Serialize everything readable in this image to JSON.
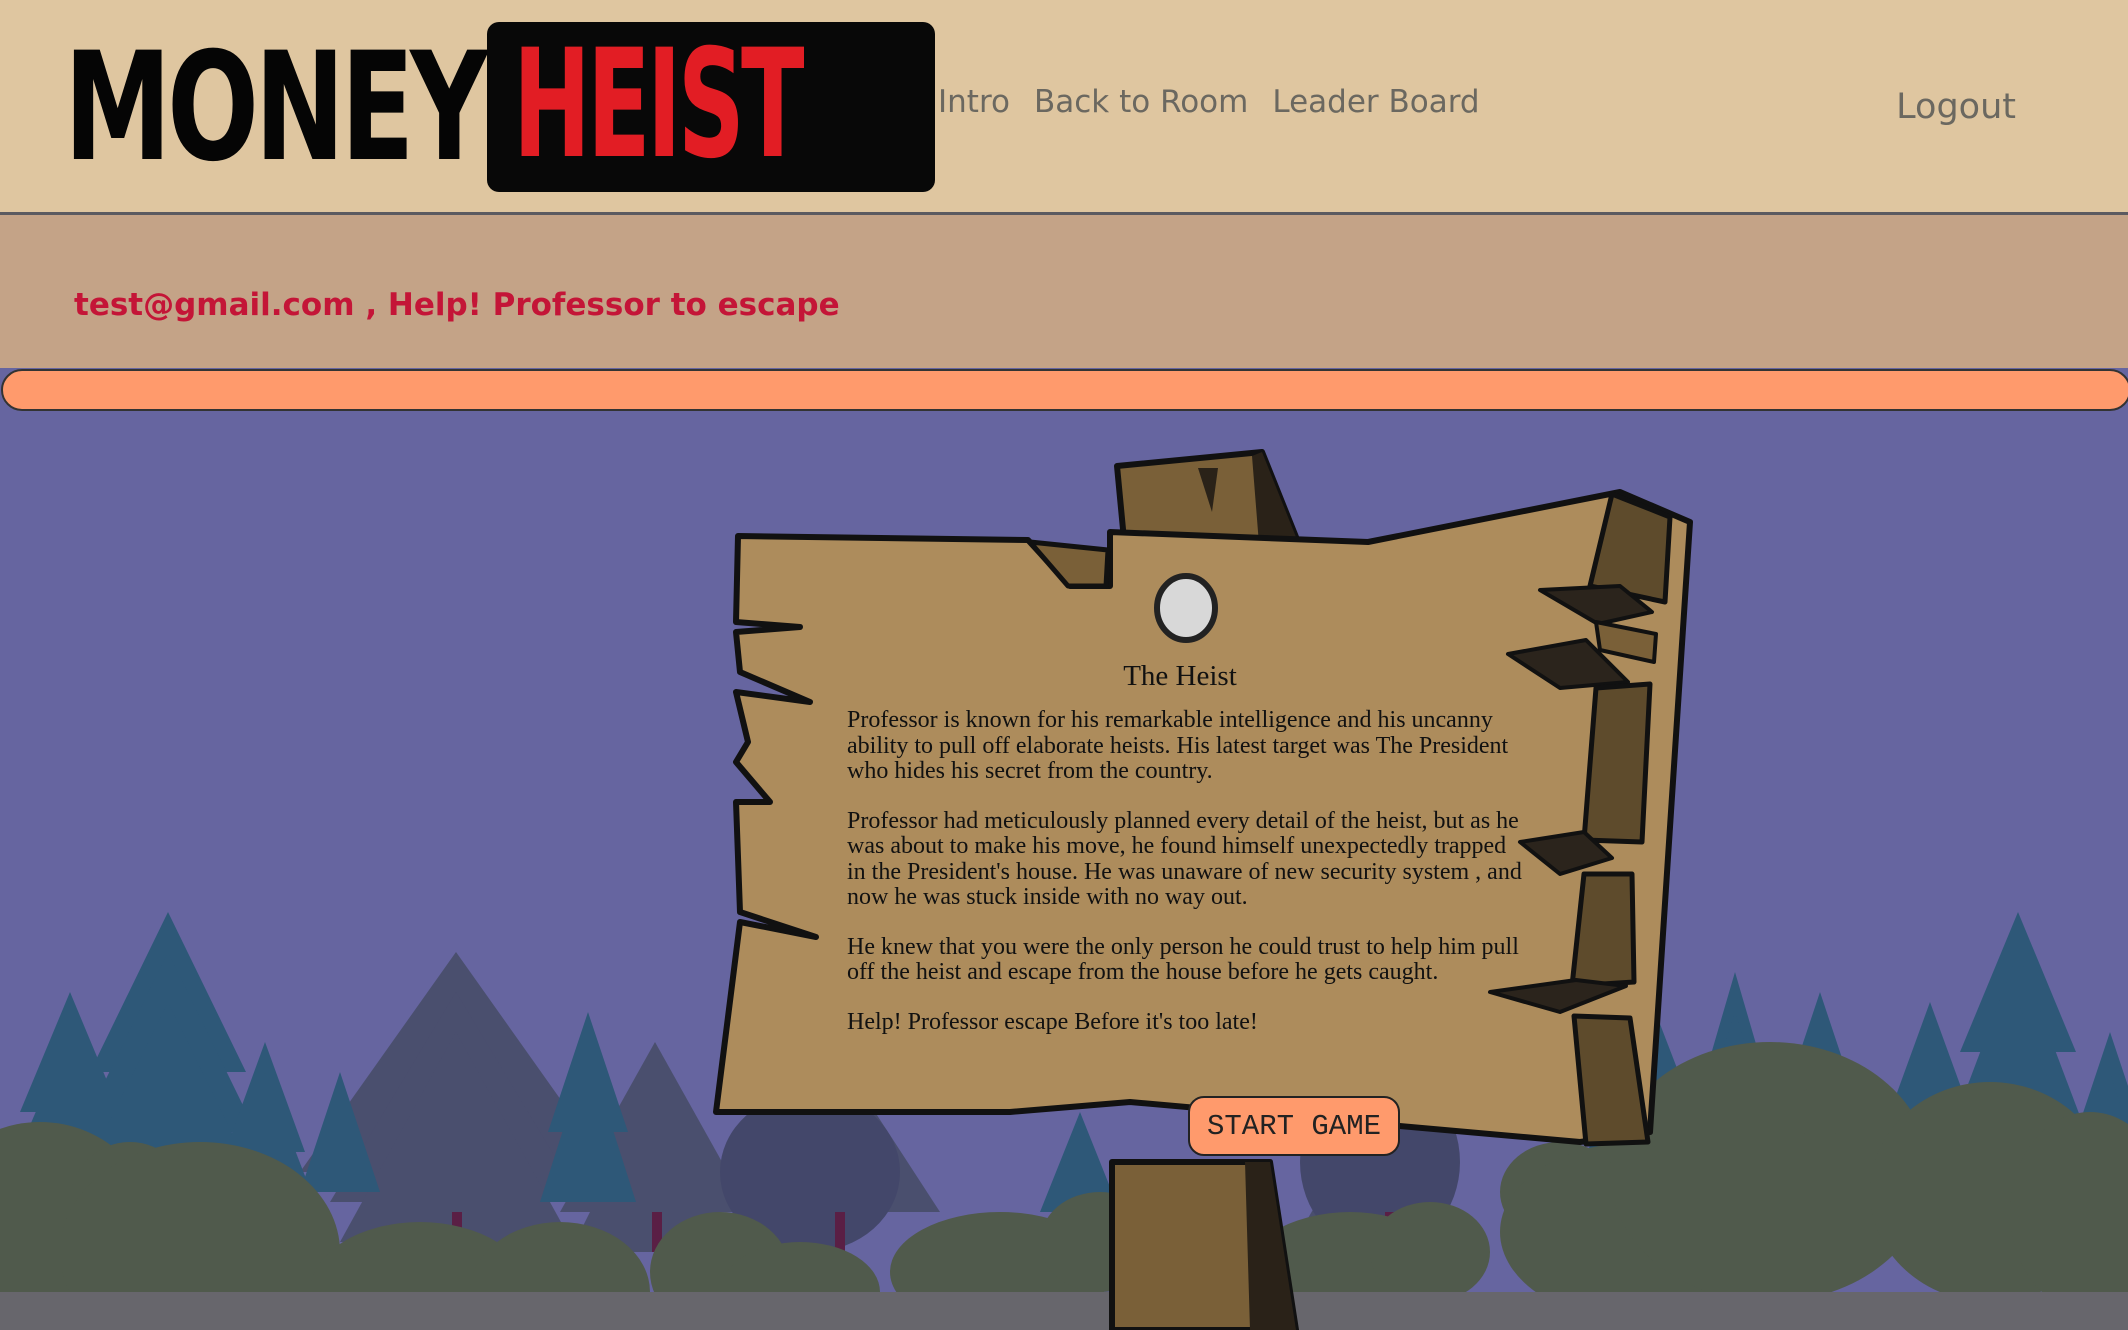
{
  "header": {
    "logo": {
      "word1": "MONEY",
      "word2": "HEIST"
    },
    "nav": [
      {
        "label": "Intro"
      },
      {
        "label": "Back to Room"
      },
      {
        "label": "Leader Board"
      }
    ],
    "logout_label": "Logout"
  },
  "banner": {
    "message": "test@gmail.com , Help! Professor to escape"
  },
  "sign": {
    "title": "The Heist",
    "paragraphs": [
      "Professor is known for his remarkable intelligence and his uncanny ability to pull off elaborate heists. His latest target was The President who hides his secret from the country.",
      "Professor had meticulously planned every detail of the heist, but as he was about to make his move, he found himself unexpectedly trapped in the President's house. He was unaware of new security system , and now he was stuck inside with no way out.",
      "He knew that you were the only person he could trust to help him pull off the heist and escape from the house before he gets caught.",
      "Help! Professor escape Before it's too late!"
    ],
    "start_button": "START GAME"
  },
  "colors": {
    "header_bg": "#dfc6a0",
    "banner_bg": "#c4a387",
    "banner_text": "#c41537",
    "progress_fill": "#ff9a6c",
    "sky": "#6665a0",
    "logo_red": "#e21d24"
  }
}
